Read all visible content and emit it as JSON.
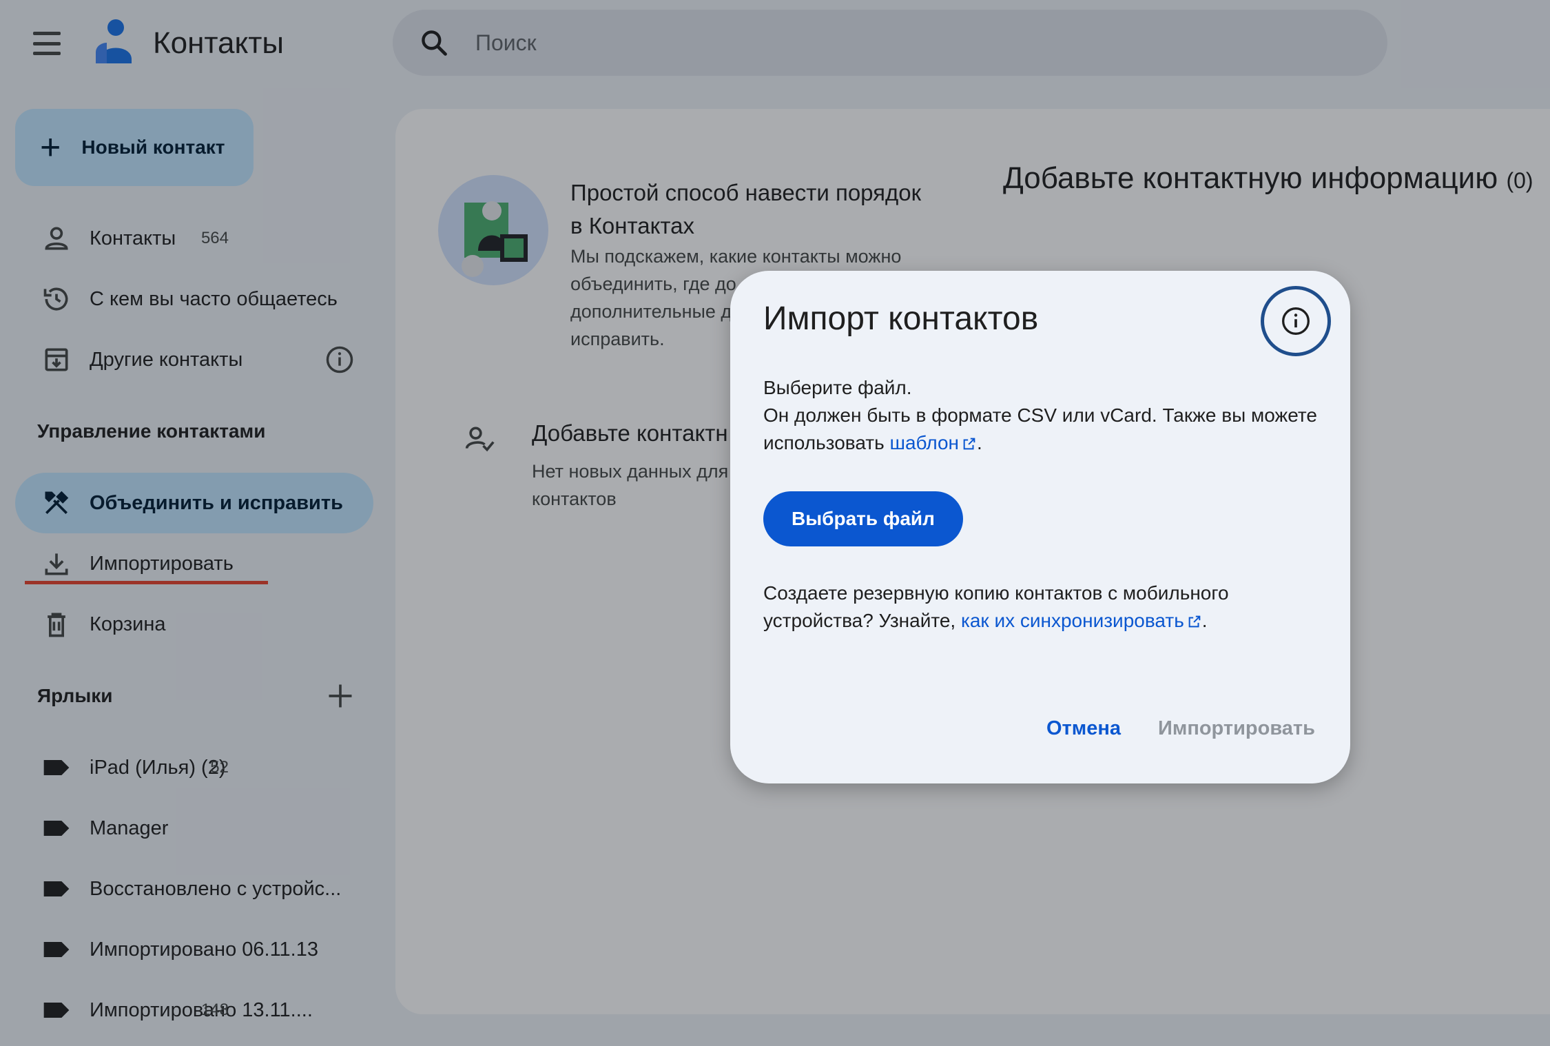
{
  "app": {
    "title": "Контакты",
    "search_placeholder": "Поиск"
  },
  "sidebar": {
    "new_contact_label": "Новый контакт",
    "items": [
      {
        "label": "Контакты",
        "count": "564",
        "icon": "person-icon"
      },
      {
        "label": "С кем вы часто общаетесь",
        "count": "",
        "icon": "history-icon"
      },
      {
        "label": "Другие контакты",
        "count": "",
        "icon": "archive-download-icon"
      }
    ],
    "manage_section_title": "Управление контактами",
    "manage_items": [
      {
        "label": "Объединить и исправить",
        "icon": "tools-icon",
        "active": true
      },
      {
        "label": "Импортировать",
        "icon": "download-icon",
        "highlighted": true
      },
      {
        "label": "Корзина",
        "icon": "trash-icon"
      }
    ],
    "labels_section_title": "Ярлыки",
    "labels": [
      {
        "label": "iPad (Илья) (2)",
        "count": "52"
      },
      {
        "label": "Manager",
        "count": ""
      },
      {
        "label": "Восстановлено с устройс...",
        "count": ""
      },
      {
        "label": "Импортировано 06.11.13",
        "count": ""
      },
      {
        "label": "Импортировано 13.11....",
        "count": "148"
      }
    ]
  },
  "main": {
    "card1_title": "Простой способ навести порядок в Контактах",
    "card1_text": "Мы подскажем, какие контакты можно объединить, где до... дополнительные д... исправить.",
    "card1_text_lines": [
      "Мы подскажем, какие контакты можно",
      "объединить, где до",
      "дополнительные д",
      "исправить."
    ],
    "card2_title": "Добавьте контактн",
    "card2_text_lines": [
      "Нет новых данных для",
      "контактов"
    ],
    "right_title": "Добавьте контактную информацию",
    "right_count": "(0)"
  },
  "dialog": {
    "title": "Импорт контактов",
    "line1": "Выберите файл.",
    "line2_prefix": "Он должен быть в формате CSV или vCard. Также вы можете использовать ",
    "template_link": "шаблон",
    "line2_suffix": ".",
    "choose_file_label": "Выбрать файл",
    "backup_prefix": "Создаете резервную копию контактов с мобильного устройства? Узнайте, ",
    "sync_link": "как их синхронизировать",
    "backup_suffix": ".",
    "cancel_label": "Отмена",
    "import_label": "Импортировать"
  },
  "colors": {
    "accent": "#0b57d0",
    "active_nav": "#c2e7ff",
    "highlight_underline": "#e8432d",
    "dialog_bg": "#eef2f8"
  }
}
